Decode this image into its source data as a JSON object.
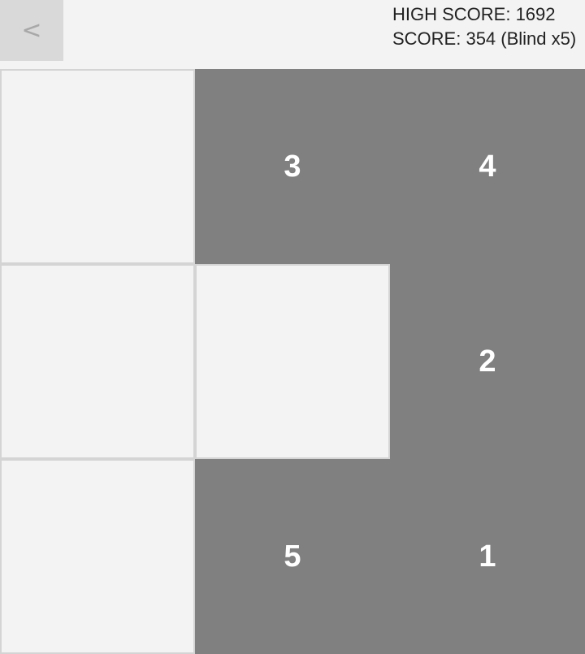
{
  "header": {
    "back_label": "<",
    "high_score": "HIGH SCORE: 1692",
    "score": "SCORE: 354 (Blind x5)"
  },
  "board": {
    "rows": 3,
    "cols": 3,
    "cells": [
      {
        "row": 0,
        "col": 0,
        "state": "empty",
        "value": ""
      },
      {
        "row": 0,
        "col": 1,
        "state": "filled",
        "value": "3"
      },
      {
        "row": 0,
        "col": 2,
        "state": "filled",
        "value": "4"
      },
      {
        "row": 1,
        "col": 0,
        "state": "empty",
        "value": ""
      },
      {
        "row": 1,
        "col": 1,
        "state": "empty",
        "value": ""
      },
      {
        "row": 1,
        "col": 2,
        "state": "filled",
        "value": "2"
      },
      {
        "row": 2,
        "col": 0,
        "state": "empty",
        "value": ""
      },
      {
        "row": 2,
        "col": 1,
        "state": "filled",
        "value": "5"
      },
      {
        "row": 2,
        "col": 2,
        "state": "filled",
        "value": "1"
      }
    ],
    "colors": {
      "filled": "#808080",
      "empty": "#f3f3f3",
      "border": "#d4d4d4"
    }
  }
}
